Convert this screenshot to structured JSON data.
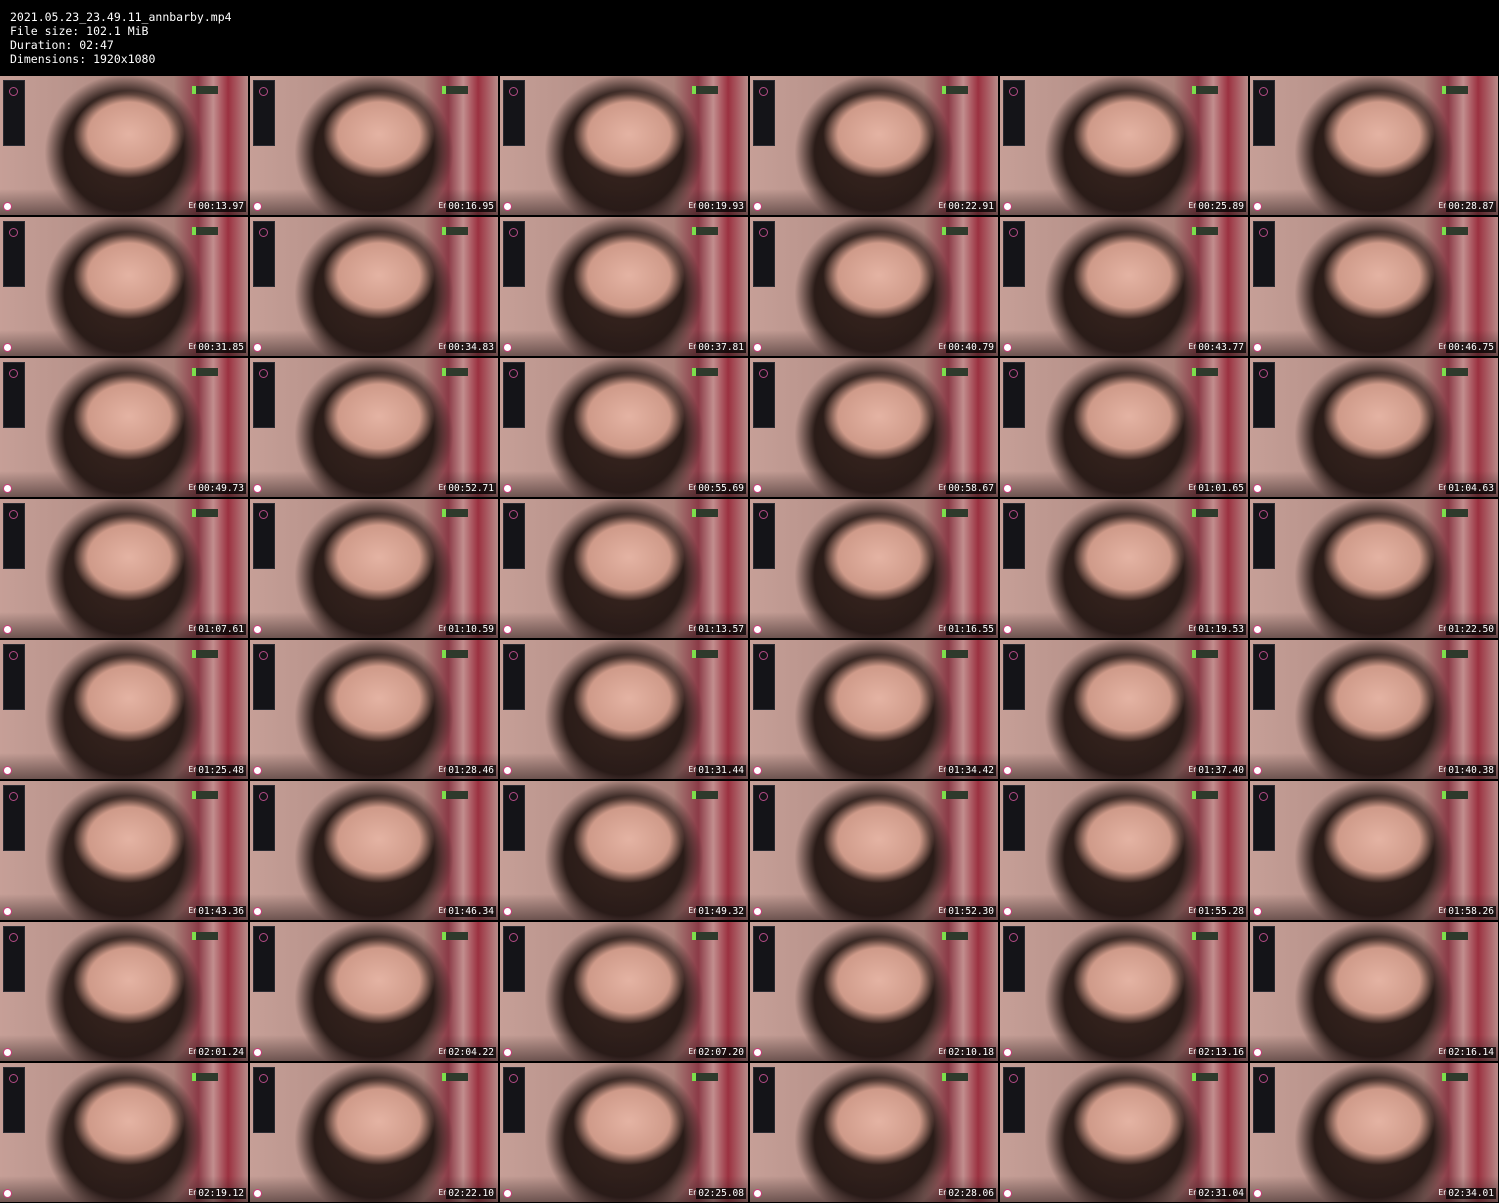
{
  "file": {
    "name": "2021.05.23_23.49.11_annbarby.mp4",
    "size_line": "File size: 102.1 MiB",
    "duration_line": "Duration: 02:47",
    "dimensions_line": "Dimensions: 1920x1080"
  },
  "thumbnails": [
    "00:13.97",
    "00:16.95",
    "00:19.93",
    "00:22.91",
    "00:25.89",
    "00:28.87",
    "00:31.85",
    "00:34.83",
    "00:37.81",
    "00:40.79",
    "00:43.77",
    "00:46.75",
    "00:49.73",
    "00:52.71",
    "00:55.69",
    "00:58.67",
    "01:01.65",
    "01:04.63",
    "01:07.61",
    "01:10.59",
    "01:13.57",
    "01:16.55",
    "01:19.53",
    "01:22.50",
    "01:25.48",
    "01:28.46",
    "01:31.44",
    "01:34.42",
    "01:37.40",
    "01:40.38",
    "01:43.36",
    "01:46.34",
    "01:49.32",
    "01:52.30",
    "01:55.28",
    "01:58.26",
    "02:01.24",
    "02:04.22",
    "02:07.20",
    "02:10.18",
    "02:13.16",
    "02:16.14",
    "02:19.12",
    "02:22.10",
    "02:25.08",
    "02:28.06",
    "02:31.04",
    "02:34.01"
  ],
  "overlay": {
    "lang_label": "En"
  },
  "colors": {
    "background": "#000000",
    "text": "#ffffff",
    "logo_green": "#7ddf4b",
    "brand_pink": "#cc3b7a"
  },
  "icons": {
    "brand": "brand-logo-icon",
    "panel": "menu-circle-icon"
  }
}
